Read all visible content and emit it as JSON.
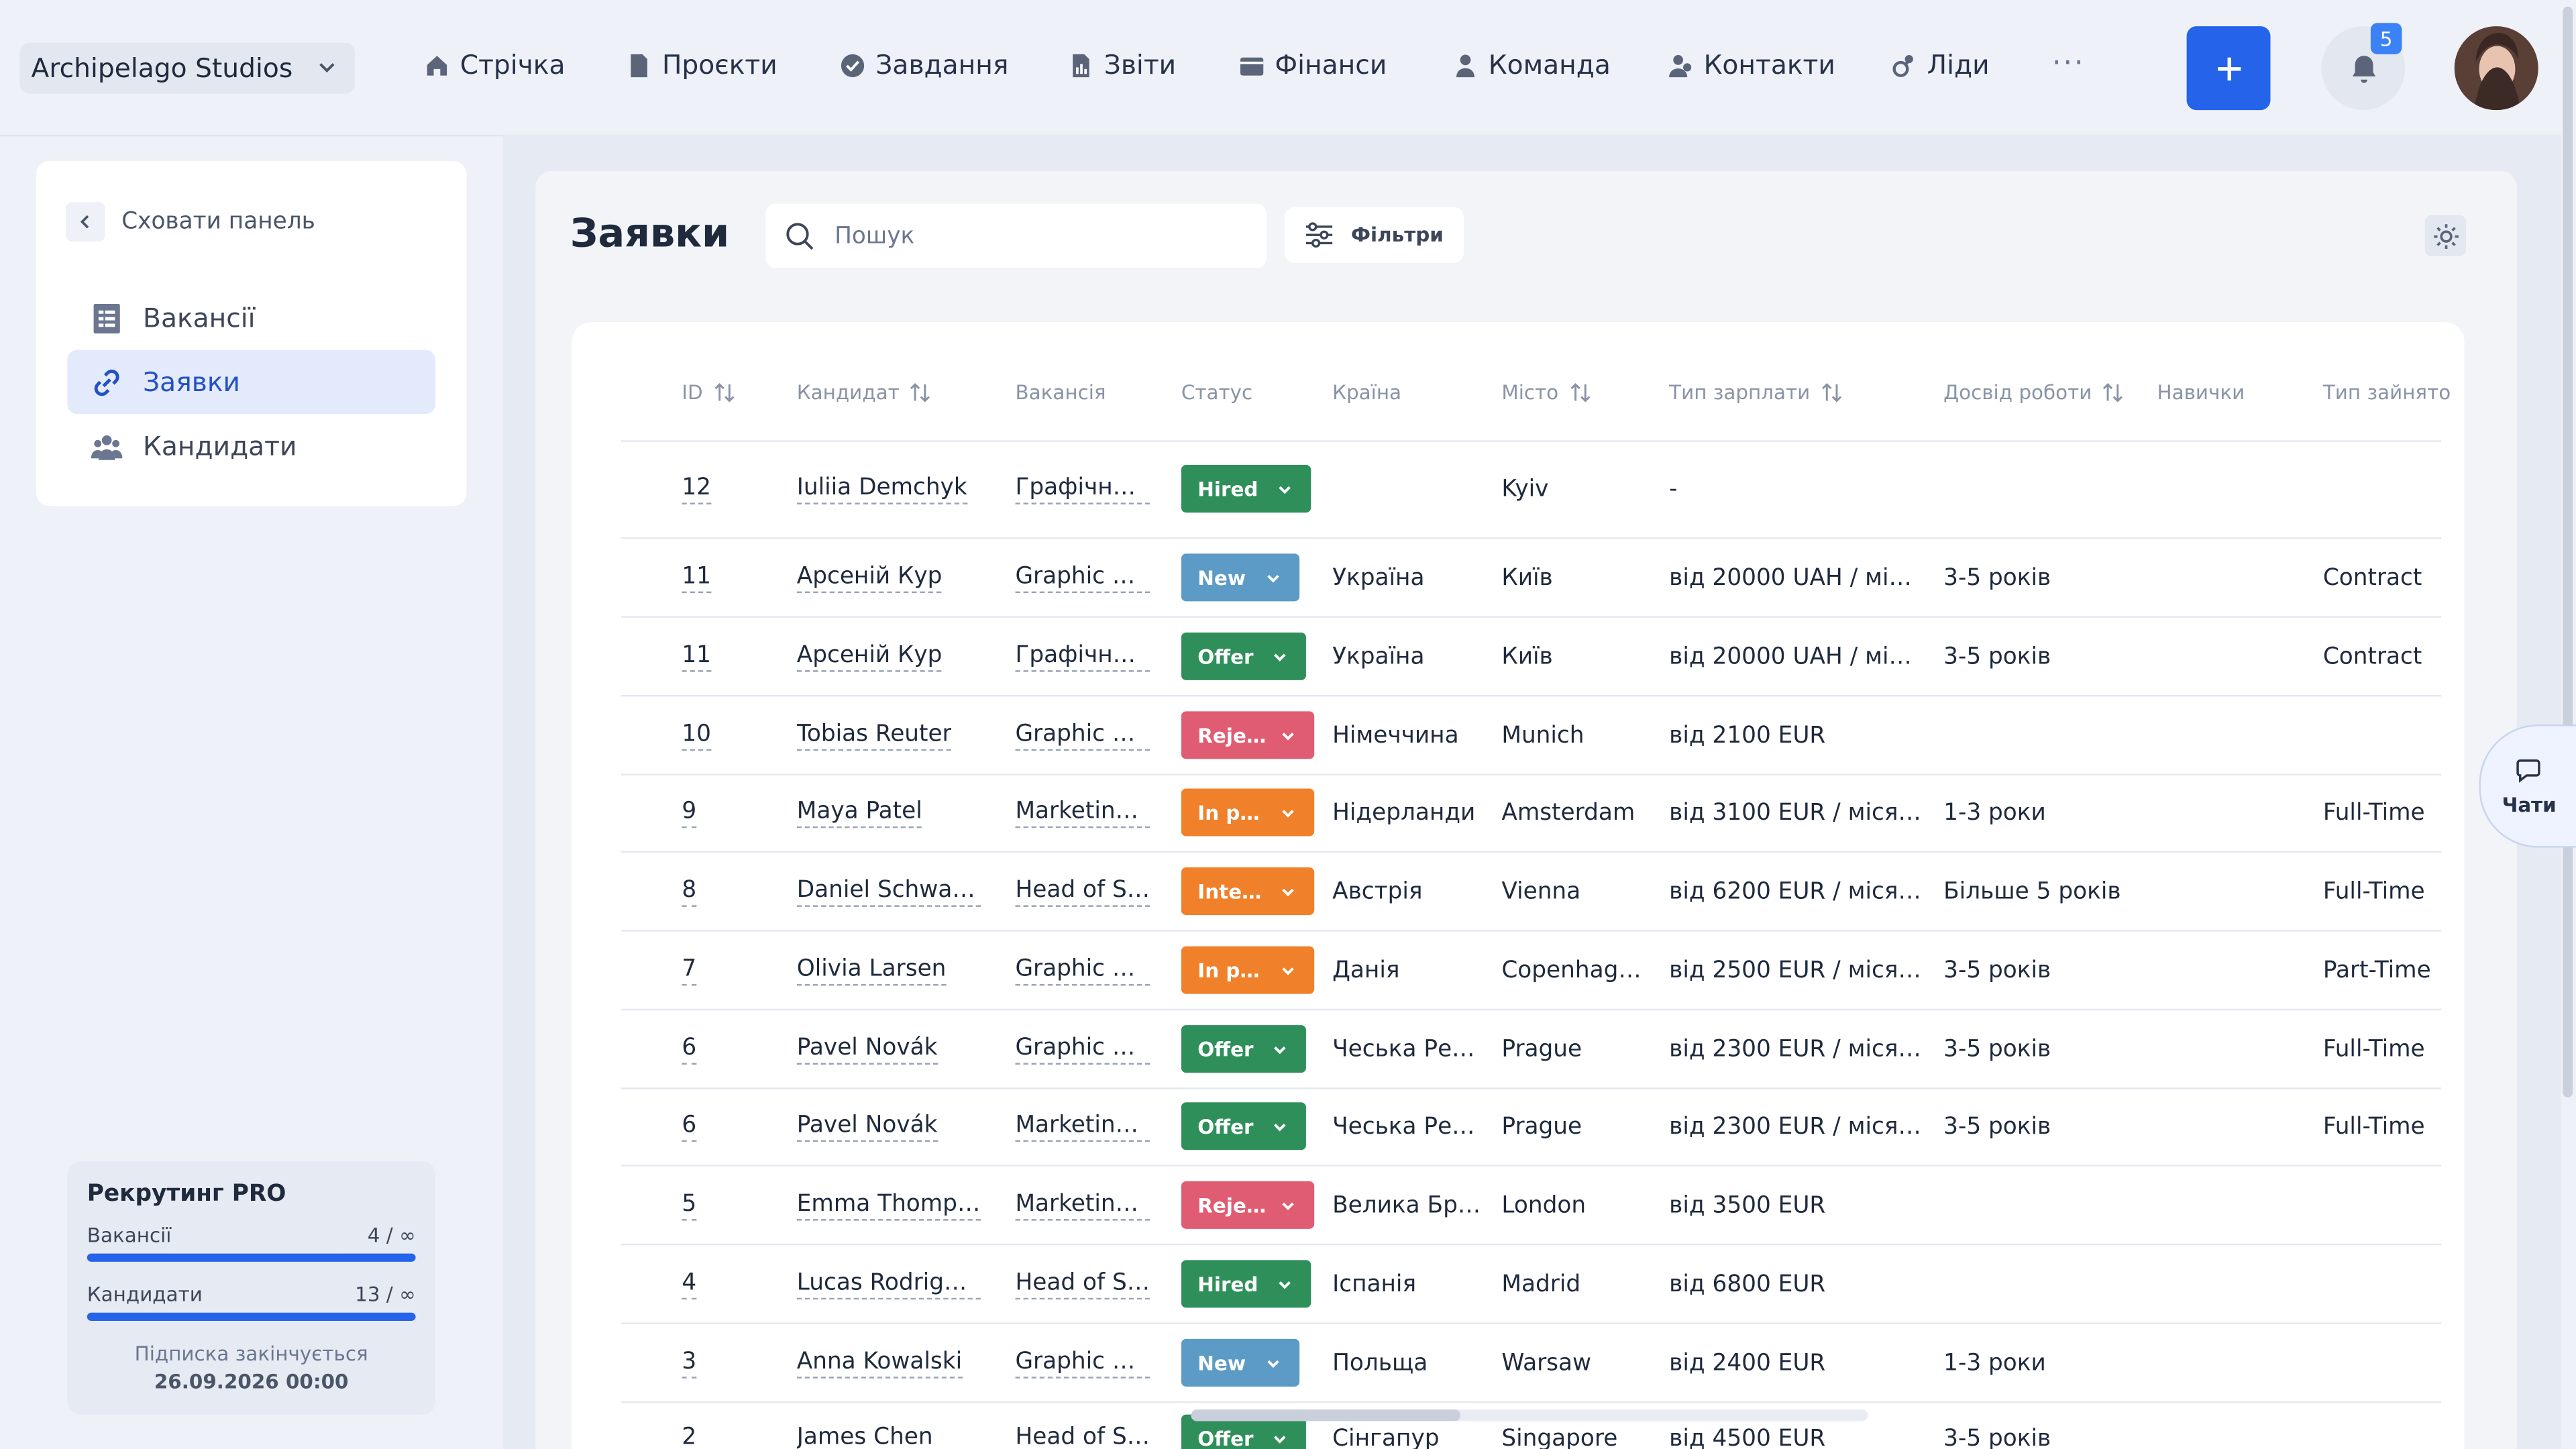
{
  "topbar": {
    "company": "Archipelago Studios",
    "nav": [
      {
        "label": "Стрічка",
        "icon": "home-icon"
      },
      {
        "label": "Проєкти",
        "icon": "document-icon"
      },
      {
        "label": "Завдання",
        "icon": "check-circle-icon"
      },
      {
        "label": "Звіти",
        "icon": "report-icon"
      },
      {
        "label": "Фінанси",
        "icon": "wallet-icon"
      },
      {
        "label": "Команда",
        "icon": "user-icon"
      },
      {
        "label": "Контакти",
        "icon": "contacts-icon"
      },
      {
        "label": "Ліди",
        "icon": "leads-icon"
      }
    ],
    "more": "···",
    "notifications_count": "5"
  },
  "sidebar": {
    "hide_label": "Сховати панель",
    "items": [
      {
        "label": "Вакансії",
        "active": false
      },
      {
        "label": "Заявки",
        "active": true
      },
      {
        "label": "Кандидати",
        "active": false
      }
    ],
    "plan": {
      "title": "Рекрутинг PRO",
      "vacancies_label": "Вакансії",
      "vacancies_value": "4 / ∞",
      "candidates_label": "Кандидати",
      "candidates_value": "13 / ∞",
      "expires_label": "Підписка закінчується",
      "expires_date": "26.09.2026 00:00"
    }
  },
  "main": {
    "title": "Заявки",
    "search_placeholder": "Пошук",
    "filters_label": "Фільтри",
    "chat_label": "Чати",
    "columns": [
      "ID",
      "Кандидат",
      "Вакансія",
      "Статус",
      "Країна",
      "Місто",
      "Тип зарплати",
      "Досвід роботи",
      "Навички",
      "Тип зайнято"
    ],
    "rows": [
      {
        "id": "12",
        "candidate": "Iuliia Demchyk",
        "vacancy": "Графічний…",
        "status": "Hired",
        "status_color": "#2f8f5b",
        "country": "",
        "city": "Kyiv",
        "salary": "-",
        "experience": "",
        "skills": "",
        "employment": ""
      },
      {
        "id": "11",
        "candidate": "Арсеній Кур",
        "vacancy": "Graphic D…",
        "status": "New",
        "status_color": "#5b9bc6",
        "country": "Україна",
        "city": "Київ",
        "salary": "від 20000 UAH / мі…",
        "experience": "3-5 років",
        "skills": "",
        "employment": "Contract"
      },
      {
        "id": "11",
        "candidate": "Арсеній Кур",
        "vacancy": "Графічний…",
        "status": "Offer",
        "status_color": "#2f8f5b",
        "country": "Україна",
        "city": "Київ",
        "salary": "від 20000 UAH / мі…",
        "experience": "3-5 років",
        "skills": "",
        "employment": "Contract"
      },
      {
        "id": "10",
        "candidate": "Tobias Reuter",
        "vacancy": "Graphic D…",
        "status": "Reje…",
        "status_color": "#e05c72",
        "country": "Німеччина",
        "city": "Munich",
        "salary": "від 2100 EUR",
        "experience": "",
        "skills": "",
        "employment": ""
      },
      {
        "id": "9",
        "candidate": "Maya Patel",
        "vacancy": "Marketing …",
        "status": "In p…",
        "status_color": "#f0802a",
        "country": "Нідерланди",
        "city": "Amsterdam",
        "salary": "від 3100 EUR / міся…",
        "experience": "1-3 роки",
        "skills": "",
        "employment": "Full-Time"
      },
      {
        "id": "8",
        "candidate": "Daniel Schwartz",
        "vacancy": "Head of Sa…",
        "status": "Inte…",
        "status_color": "#f0802a",
        "country": "Австрія",
        "city": "Vienna",
        "salary": "від 6200 EUR / міся…",
        "experience": "Більше 5 років",
        "skills": "",
        "employment": "Full-Time"
      },
      {
        "id": "7",
        "candidate": "Olivia Larsen",
        "vacancy": "Graphic D…",
        "status": "In p…",
        "status_color": "#f0802a",
        "country": "Данія",
        "city": "Copenhag…",
        "salary": "від 2500 EUR / міся…",
        "experience": "3-5 років",
        "skills": "",
        "employment": "Part-Time"
      },
      {
        "id": "6",
        "candidate": "Pavel Novák",
        "vacancy": "Graphic D…",
        "status": "Offer",
        "status_color": "#2f8f5b",
        "country": "Чеська Ре…",
        "city": "Prague",
        "salary": "від 2300 EUR / міся…",
        "experience": "3-5 років",
        "skills": "",
        "employment": "Full-Time"
      },
      {
        "id": "6",
        "candidate": "Pavel Novák",
        "vacancy": "Marketing …",
        "status": "Offer",
        "status_color": "#2f8f5b",
        "country": "Чеська Ре…",
        "city": "Prague",
        "salary": "від 2300 EUR / міся…",
        "experience": "3-5 років",
        "skills": "",
        "employment": "Full-Time"
      },
      {
        "id": "5",
        "candidate": "Emma Thomps…",
        "vacancy": "Marketing …",
        "status": "Reje…",
        "status_color": "#e05c72",
        "country": "Велика Бр…",
        "city": "London",
        "salary": "від 3500 EUR",
        "experience": "",
        "skills": "",
        "employment": ""
      },
      {
        "id": "4",
        "candidate": "Lucas Rodriguez",
        "vacancy": "Head of Sa…",
        "status": "Hired",
        "status_color": "#2f8f5b",
        "country": "Іспанія",
        "city": "Madrid",
        "salary": "від 6800 EUR",
        "experience": "",
        "skills": "",
        "employment": ""
      },
      {
        "id": "3",
        "candidate": "Anna Kowalski",
        "vacancy": "Graphic D…",
        "status": "New",
        "status_color": "#5b9bc6",
        "country": "Польща",
        "city": "Warsaw",
        "salary": "від 2400 EUR",
        "experience": "1-3 роки",
        "skills": "",
        "employment": ""
      },
      {
        "id": "2",
        "candidate": "James Chen",
        "vacancy": "Head of Sa…",
        "status": "Offer",
        "status_color": "#2f8f5b",
        "country": "Сінгапур",
        "city": "Singapore",
        "salary": "від 4500 EUR",
        "experience": "3-5 років",
        "skills": "",
        "employment": ""
      }
    ]
  }
}
